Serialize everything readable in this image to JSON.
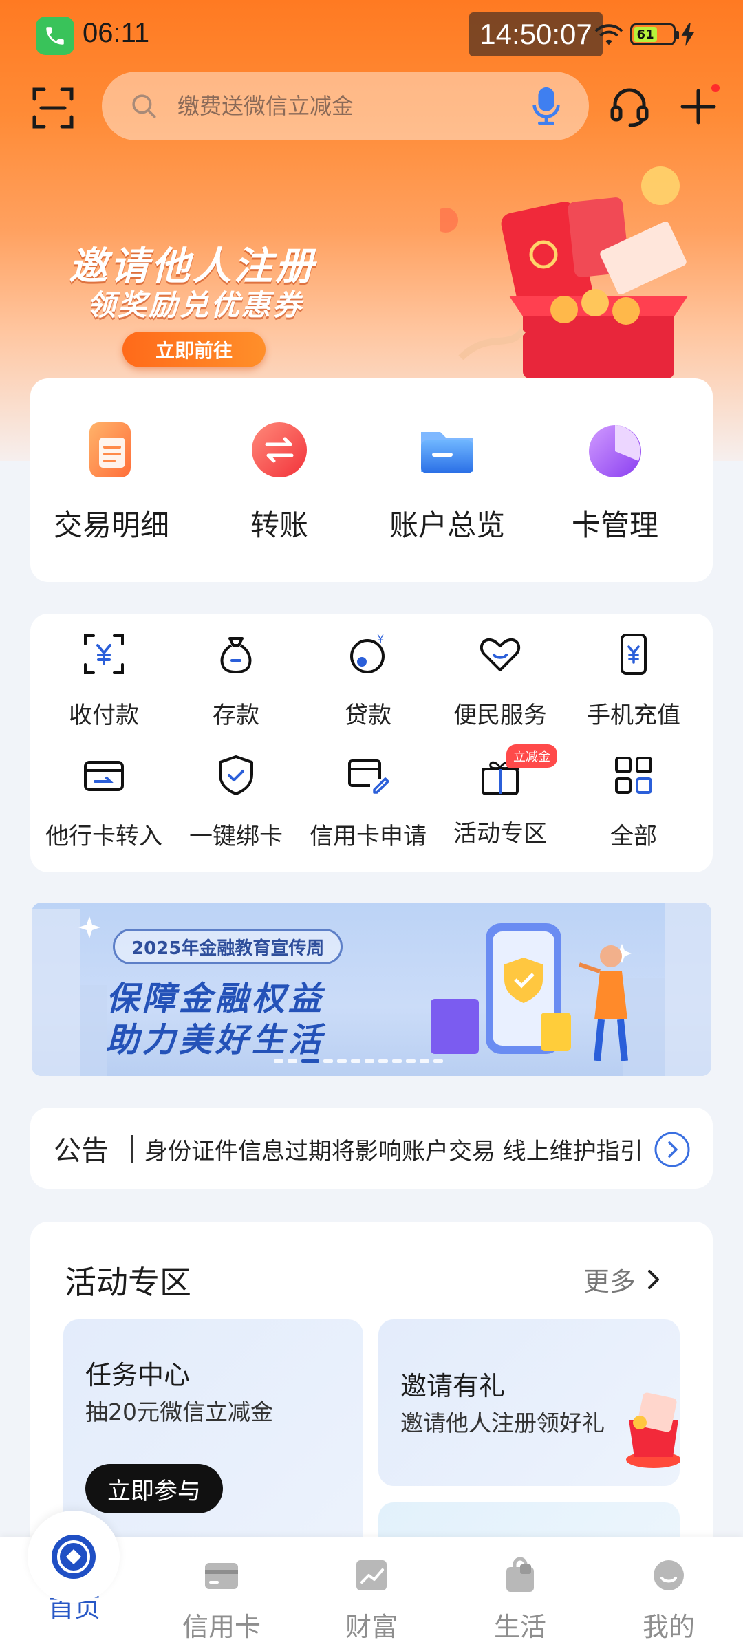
{
  "status_bar": {
    "time": "06:11",
    "clock_overlay": "14:50:07",
    "battery": "61"
  },
  "search": {
    "placeholder": "缴费送微信立减金"
  },
  "banner": {
    "title": "邀请他人注册",
    "subtitle": "领奖励兑优惠券",
    "button": "立即前往"
  },
  "quick_actions": [
    {
      "label": "交易明细",
      "icon": "document-icon"
    },
    {
      "label": "转账",
      "icon": "transfer-icon"
    },
    {
      "label": "账户总览",
      "icon": "folder-icon"
    },
    {
      "label": "卡管理",
      "icon": "pie-icon"
    }
  ],
  "services": [
    {
      "label": "收付款",
      "icon": "scan-yuan-icon"
    },
    {
      "label": "存款",
      "icon": "money-bag-icon"
    },
    {
      "label": "贷款",
      "icon": "loan-icon"
    },
    {
      "label": "便民服务",
      "icon": "heart-icon"
    },
    {
      "label": "手机充值",
      "icon": "phone-recharge-icon"
    },
    {
      "label": "他行卡转入",
      "icon": "card-in-icon"
    },
    {
      "label": "一键绑卡",
      "icon": "shield-check-icon"
    },
    {
      "label": "信用卡申请",
      "icon": "credit-card-edit-icon"
    },
    {
      "label": "活动专区",
      "icon": "gift-icon",
      "badge": "立减金"
    },
    {
      "label": "全部",
      "icon": "grid-icon"
    }
  ],
  "edu_banner": {
    "tag": "2025年金融教育宣传周",
    "line1": "保障金融权益",
    "line2": "助力美好生活"
  },
  "notice": {
    "label": "公告",
    "text": "身份证件信息过期将影响账户交易 线上维护指引"
  },
  "activities": {
    "title": "活动专区",
    "more": "更多",
    "tiles": [
      {
        "title": "任务中心",
        "subtitle": "抽20元微信立减金",
        "button": "立即参与"
      },
      {
        "title": "邀请有礼",
        "subtitle": "邀请他人注册领好礼"
      }
    ]
  },
  "tabs": [
    {
      "label": "首页",
      "active": true
    },
    {
      "label": "信用卡"
    },
    {
      "label": "财富"
    },
    {
      "label": "生活"
    },
    {
      "label": "我的"
    }
  ],
  "colors": {
    "accent": "#2858c6",
    "hero": "#ff7a22"
  }
}
